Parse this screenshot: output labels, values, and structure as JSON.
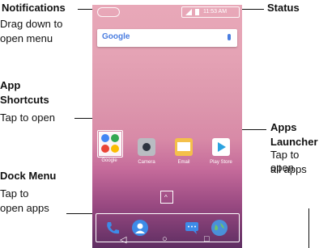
{
  "callouts": {
    "notifications": {
      "title": "Notifications",
      "text_lines": [
        "Drag down to",
        "open menu"
      ]
    },
    "status": {
      "title": "Status"
    },
    "app_shortcuts": {
      "title_lines": [
        "App",
        "Shortcuts"
      ],
      "text": "Tap to open"
    },
    "apps_launcher": {
      "title_lines": [
        "Apps",
        "Launcher"
      ],
      "text_lines": [
        "Tap to open",
        "all apps"
      ]
    },
    "dock_menu": {
      "title": "Dock Menu",
      "text_lines": [
        "Tap to",
        "open apps"
      ]
    }
  },
  "status_bar": {
    "time": "11:53 AM"
  },
  "search": {
    "logo": "Google"
  },
  "apps": [
    {
      "label": "Google",
      "icon": "google-folder-icon",
      "color": "#ffffff"
    },
    {
      "label": "Camera",
      "icon": "camera-icon",
      "color": "#b9bcc2"
    },
    {
      "label": "Email",
      "icon": "email-icon",
      "color": "#f4c04a"
    },
    {
      "label": "Play Store",
      "icon": "play-store-icon",
      "color": "#ffffff"
    }
  ],
  "dock": [
    {
      "icon": "phone-icon",
      "color": "#3d8be8"
    },
    {
      "icon": "contacts-icon",
      "color": "#3d8be8"
    },
    {
      "icon": "messages-icon",
      "color": "#3d8be8"
    },
    {
      "icon": "browser-icon",
      "color": "#4a90d9"
    }
  ],
  "navbar": {
    "back": "◁",
    "home": "○",
    "recents": "□"
  }
}
